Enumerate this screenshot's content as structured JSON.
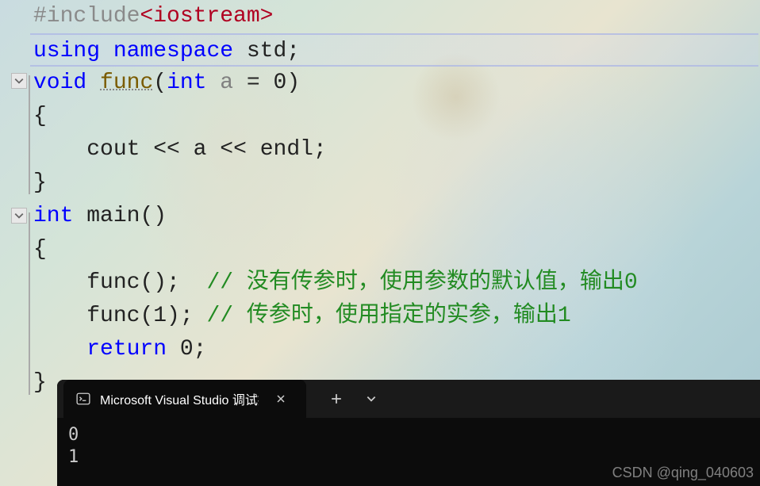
{
  "code": {
    "line1_preproc": "#include",
    "line1_header": "<iostream>",
    "line2_using": "using",
    "line2_namespace": "namespace",
    "line2_std": "std",
    "line3_void": "void",
    "line3_func": "func",
    "line3_int": "int",
    "line3_param": "a",
    "line3_eq": "=",
    "line3_val": "0",
    "line4_brace": "{",
    "line5_indent": "    ",
    "line5_cout": "cout",
    "line5_op1": "<<",
    "line5_a": "a",
    "line5_op2": "<<",
    "line5_endl": "endl",
    "line6_brace": "}",
    "line7_int": "int",
    "line7_main": "main",
    "line8_brace": "{",
    "line9_indent": "    ",
    "line9_func": "func",
    "line9_paren": "();",
    "line9_gap": "  ",
    "line9_comment": "// 没有传参时，使用参数的默认值，输出0",
    "line10_indent": "    ",
    "line10_func": "func",
    "line10_args": "(1);",
    "line10_gap": " ",
    "line10_comment": "// 传参时，使用指定的实参，输出1",
    "line11_indent": "    ",
    "line11_return": "return",
    "line11_val": "0",
    "line12_brace": "}"
  },
  "terminal": {
    "tab_label": "Microsoft Visual Studio 调试控",
    "output_line1": "0",
    "output_line2": "1"
  },
  "watermark": "CSDN @qing_040603"
}
